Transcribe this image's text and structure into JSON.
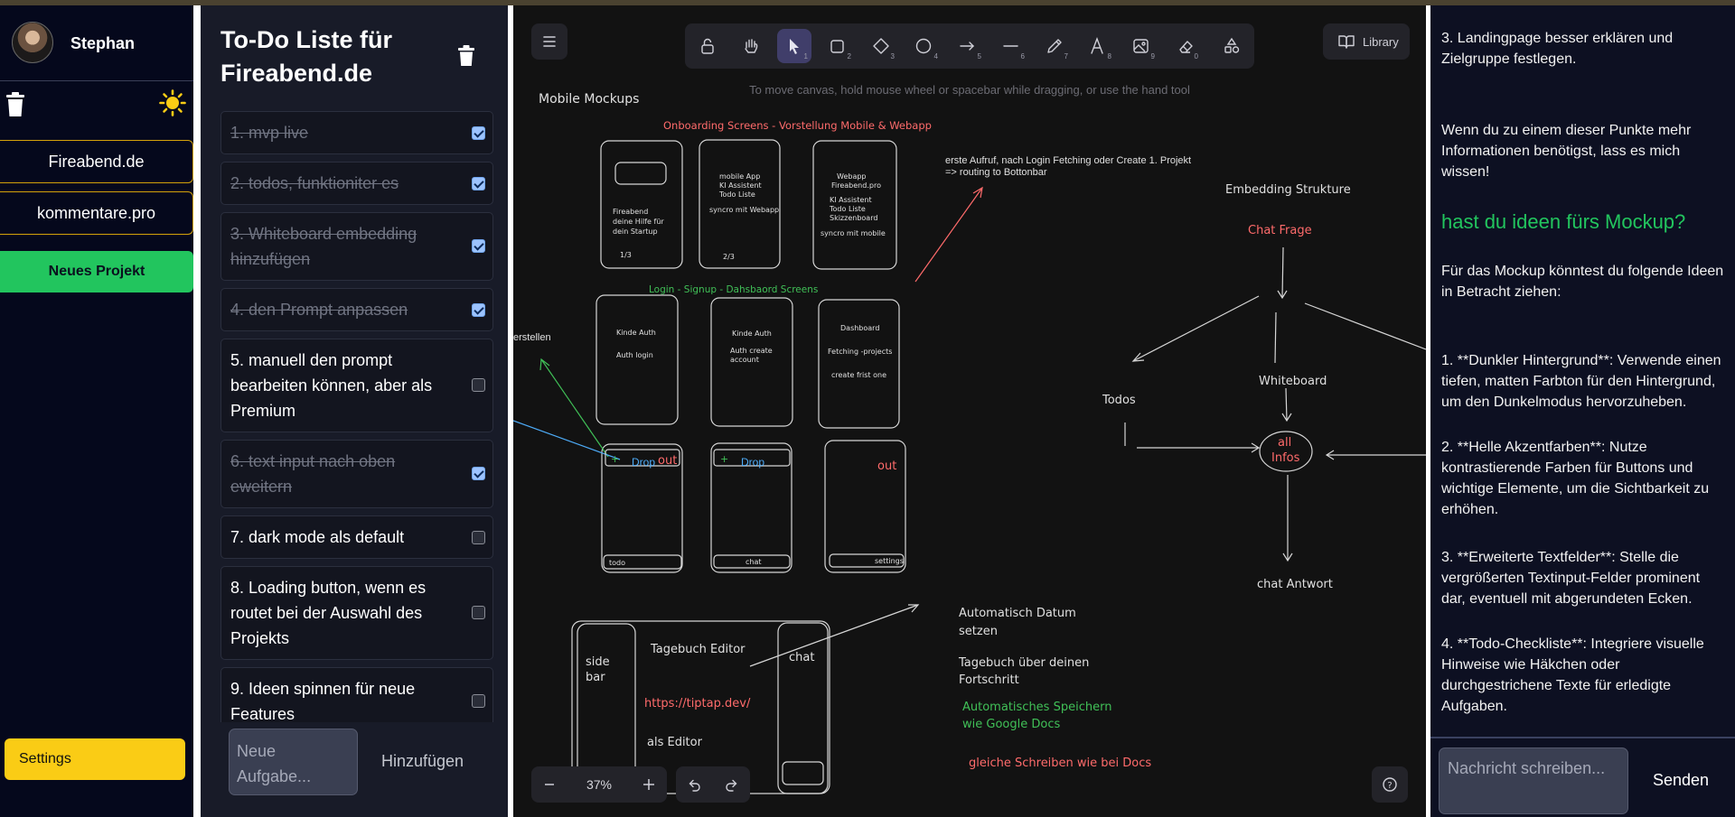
{
  "sidebar": {
    "username": "Stephan",
    "projects": [
      "Fireabend.de",
      "kommentare.pro"
    ],
    "new_project": "Neues Projekt",
    "settings": "Settings"
  },
  "todo": {
    "title": "To-Do Liste für Fireabend.de",
    "items": [
      {
        "text": "1. mvp live",
        "done": true
      },
      {
        "text": "2. todos, funktioniter es",
        "done": true
      },
      {
        "text": "3. Whiteboard embedding hinzufügen",
        "done": true
      },
      {
        "text": "4. den Prompt anpassen",
        "done": true
      },
      {
        "text": "5. manuell den prompt bearbeiten können, aber als Premium",
        "done": false
      },
      {
        "text": "6. text input nach oben eweitern",
        "done": true
      },
      {
        "text": "7. dark mode als default",
        "done": false
      },
      {
        "text": "8. Loading button, wenn es routet bei der Auswahl des Projekts",
        "done": false
      },
      {
        "text": "9. Ideen spinnen für neue Features",
        "done": false
      }
    ],
    "input_placeholder": "Neue Aufgabe...",
    "add_label": "Hinzufügen"
  },
  "canvas": {
    "library_label": "Library",
    "hint": "To move canvas, hold mouse wheel or spacebar while dragging, or use the hand tool",
    "zoom": "37%",
    "tools": [
      {
        "icon": "lock-icon",
        "num": ""
      },
      {
        "icon": "hand-icon",
        "num": ""
      },
      {
        "icon": "pointer-icon",
        "num": "1"
      },
      {
        "icon": "rectangle-icon",
        "num": "2"
      },
      {
        "icon": "diamond-icon",
        "num": "3"
      },
      {
        "icon": "ellipse-icon",
        "num": "4"
      },
      {
        "icon": "arrow-icon",
        "num": "5"
      },
      {
        "icon": "line-icon",
        "num": "6"
      },
      {
        "icon": "pencil-icon",
        "num": "7"
      },
      {
        "icon": "text-icon",
        "num": "8"
      },
      {
        "icon": "image-icon",
        "num": "9"
      },
      {
        "icon": "eraser-icon",
        "num": "0"
      },
      {
        "icon": "shapes-icon",
        "num": ""
      }
    ],
    "drawing": {
      "mobile_mockups": "Mobile Mockups",
      "onboarding": "Onboarding Screens - Vorstellung Mobile & Webapp",
      "s1_lines": [
        "Fireabend",
        "deine Hilfe für",
        "dein Startup"
      ],
      "s1_page": "1/3",
      "s2_lines": [
        "mobile App",
        "KI Assistent",
        "Todo Liste",
        "",
        "syncro mit Webapp"
      ],
      "s2_page": "2/3",
      "s3_lines": [
        "Webapp",
        "Fireabend.pro",
        "",
        "KI Assistent",
        "Todo Liste",
        "Skizzenboard",
        "",
        "syncro mit mobile"
      ],
      "login_heading": "Login - Signup - Dahsbaord Screens",
      "l1_lines": [
        "Kinde Auth",
        "",
        "Auth login"
      ],
      "l2_lines": [
        "Kinde Auth",
        "",
        "Auth create",
        "account"
      ],
      "l3_lines": [
        "Dashboard",
        "",
        "Fetching -projects",
        "",
        "create frist one"
      ],
      "erstellen": "erstellen",
      "first_call": [
        "erste Aufruf, nach Login Fetching oder Create 1. Projekt",
        "=> routing to Bottonbar"
      ],
      "drop": "Drop",
      "out": "out",
      "tab_todo": "todo",
      "tab_chat": "chat",
      "tab_settings": "settings",
      "embedding": "Embedding Strukture",
      "chat_frage": "Chat Frage",
      "todos": "Todos",
      "whiteboard": "Whiteboard",
      "all_infos": [
        "all",
        "Infos"
      ],
      "chat_antwort": "chat Antwort",
      "side_bar": [
        "side",
        "bar"
      ],
      "tagebuch_editor": "Tagebuch Editor",
      "chat_label": "chat",
      "tiptap": "https://tiptap.dev/",
      "als_editor": "als Editor",
      "auto_datum": [
        "Automatisch Datum",
        "setzen"
      ],
      "tagebuch_fortschritt": [
        "Tagebuch über deinen",
        "Fortschritt"
      ],
      "auto_speichern": [
        "Automatisches Speichern",
        "wie Google Docs"
      ],
      "gleiche_schreiben": "gleiche Schreiben wie bei Docs"
    }
  },
  "chat": {
    "messages": [
      {
        "kind": "p",
        "text": "3. Landingpage besser erklären und Zielgruppe festlegen."
      },
      {
        "kind": "p",
        "text": "Wenn du zu einem dieser Punkte mehr Informationen benötigst, lass es mich wissen!"
      },
      {
        "kind": "h",
        "text": "hast du ideen fürs Mockup?"
      },
      {
        "kind": "p",
        "text": "Für das Mockup könntest du folgende Ideen in Betracht ziehen:"
      },
      {
        "kind": "p",
        "text": "1. **Dunkler Hintergrund**: Verwende einen tiefen, matten Farbton für den Hintergrund, um den Dunkelmodus hervorzuheben."
      },
      {
        "kind": "p",
        "text": "2. **Helle Akzentfarben**: Nutze kontrastierende Farben für Buttons und wichtige Elemente, um die Sichtbarkeit zu erhöhen."
      },
      {
        "kind": "p",
        "text": "3. **Erweiterte Textfelder**: Stelle die vergrößerten Textinput-Felder prominent dar, eventuell mit abgerundeten Ecken."
      },
      {
        "kind": "p",
        "text": "4. **Todo-Checkliste**: Integriere visuelle Hinweise wie Häkchen oder durchgestrichene Texte für erledigte Aufgaben."
      }
    ],
    "input_placeholder": "Nachricht schreiben...",
    "send_label": "Senden"
  },
  "colors": {
    "accent_green": "#22c55e",
    "accent_yellow": "#facc15",
    "project_border": "#d4a20a",
    "sketch_red": "#ff6b6b",
    "sketch_green": "#40c057",
    "sketch_blue": "#4dabf7"
  }
}
